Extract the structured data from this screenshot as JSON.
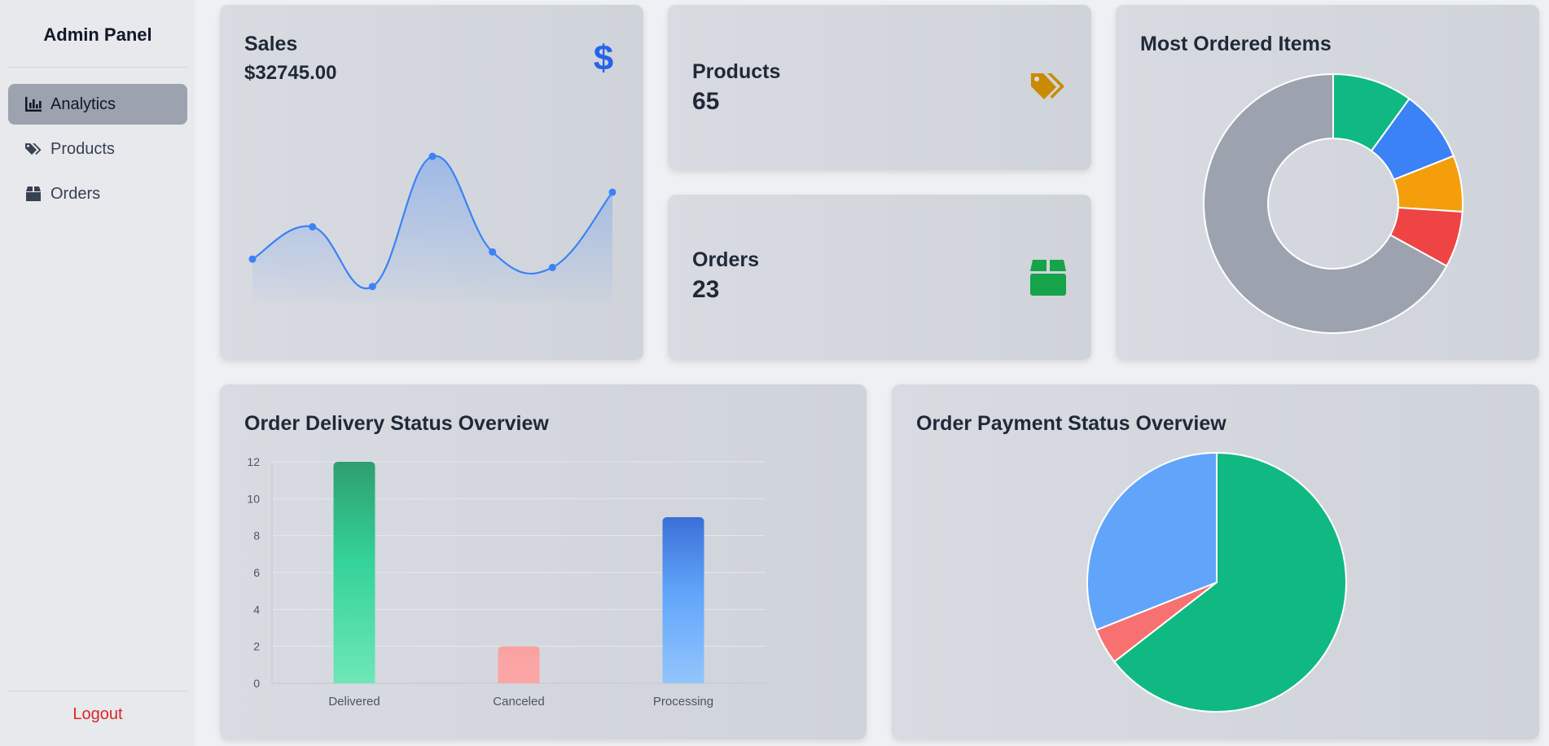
{
  "sidebar": {
    "brand": "Admin Panel",
    "items": [
      {
        "label": "Analytics",
        "icon": "bar-chart-icon",
        "active": true
      },
      {
        "label": "Products",
        "icon": "tags-icon",
        "active": false
      },
      {
        "label": "Orders",
        "icon": "box-icon",
        "active": false
      }
    ],
    "logout": "Logout"
  },
  "sales": {
    "title": "Sales",
    "amount": "$32745.00",
    "icon": "dollar-icon",
    "color": "#3b82f6",
    "chart_data": {
      "type": "area",
      "values": [
        3.4,
        6.1,
        1.1,
        12.0,
        4.0,
        2.7,
        9.0
      ],
      "ylim": [
        0,
        15
      ]
    }
  },
  "products": {
    "title": "Products",
    "value": "65",
    "icon": "tag-icon",
    "color": "#ca8a04"
  },
  "orders": {
    "title": "Orders",
    "value": "23",
    "icon": "box-open-icon",
    "color": "#16a34a"
  },
  "most_ordered": {
    "title": "Most Ordered Items",
    "chart_data": {
      "type": "pie",
      "donut": true,
      "values": [
        10,
        9,
        7,
        7,
        67
      ],
      "colors": [
        "#10b981",
        "#3b82f6",
        "#f59e0b",
        "#ef4444",
        "#9ca3af"
      ]
    }
  },
  "delivery": {
    "title": "Order Delivery Status Overview",
    "chart_data": {
      "type": "bar",
      "categories": [
        "Delivered",
        "Canceled",
        "Processing"
      ],
      "values": [
        12,
        2,
        9
      ],
      "ylim": [
        0,
        12
      ],
      "yticks": [
        0,
        2,
        4,
        6,
        8,
        10,
        12
      ],
      "grid": true,
      "colors": [
        [
          "#6ee7b7",
          "#34d399",
          "#2f9e6f"
        ],
        [
          "#fca5a5",
          "#fca5a5",
          "#f8a0a0"
        ],
        [
          "#93c5fd",
          "#60a5fa",
          "#3b6fd8"
        ]
      ]
    }
  },
  "payment": {
    "title": "Order Payment Status Overview",
    "chart_data": {
      "type": "pie",
      "values": [
        64.5,
        4.5,
        31
      ],
      "colors": [
        "#10b981",
        "#f87171",
        "#60a5fa"
      ]
    }
  }
}
